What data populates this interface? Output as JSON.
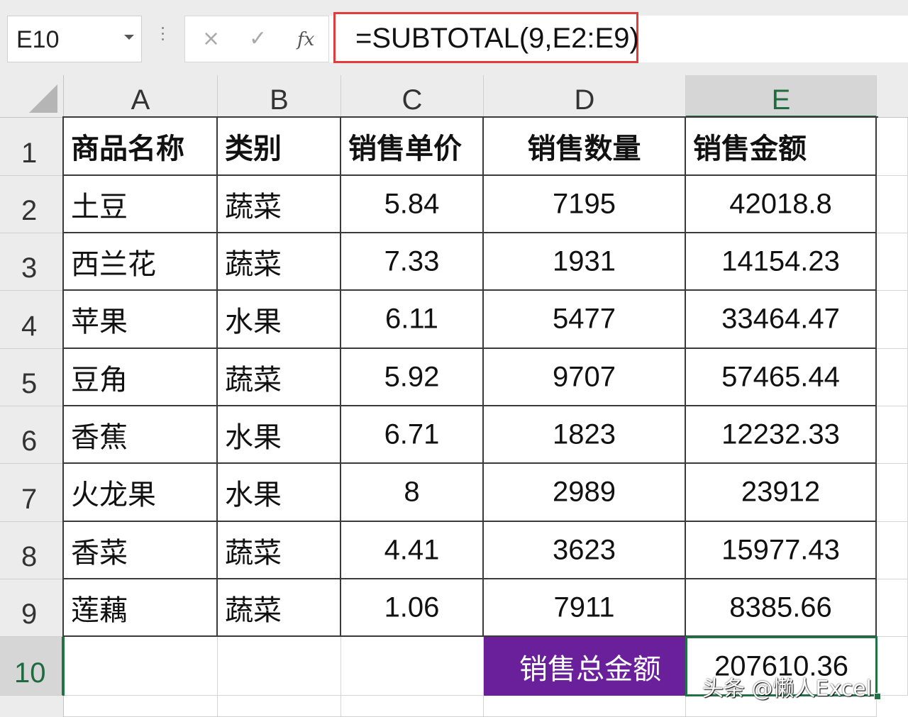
{
  "namebox": {
    "value": "E10"
  },
  "formula_bar": {
    "cancel_glyph": "×",
    "enter_glyph": "✓",
    "fx_glyph": "fx",
    "formula": "=SUBTOTAL(9,E2:E9)"
  },
  "columns": [
    "A",
    "B",
    "C",
    "D",
    "E"
  ],
  "rows": [
    "1",
    "2",
    "3",
    "4",
    "5",
    "6",
    "7",
    "8",
    "9",
    "10"
  ],
  "table": {
    "headers": [
      "商品名称",
      "类别",
      "销售单价",
      "销售数量",
      "销售金额"
    ],
    "rows": [
      [
        "土豆",
        "蔬菜",
        "5.84",
        "7195",
        "42018.8"
      ],
      [
        "西兰花",
        "蔬菜",
        "7.33",
        "1931",
        "14154.23"
      ],
      [
        "苹果",
        "水果",
        "6.11",
        "5477",
        "33464.47"
      ],
      [
        "豆角",
        "蔬菜",
        "5.92",
        "9707",
        "57465.44"
      ],
      [
        "香蕉",
        "水果",
        "6.71",
        "1823",
        "12232.33"
      ],
      [
        "火龙果",
        "水果",
        "8",
        "2989",
        "23912"
      ],
      [
        "香菜",
        "蔬菜",
        "4.41",
        "3623",
        "15977.43"
      ],
      [
        "莲藕",
        "蔬菜",
        "1.06",
        "7911",
        "8385.66"
      ]
    ],
    "total_label": "销售总金额",
    "total_value": "207610.36"
  },
  "watermark": "头条 @懒人Excel",
  "colors": {
    "highlight_purple": "#6a1f9b",
    "formula_border": "#e23b3b",
    "selection_green": "#217346"
  }
}
